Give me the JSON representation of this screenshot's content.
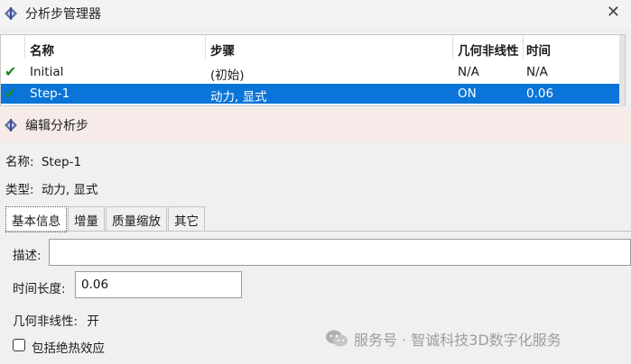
{
  "step_manager": {
    "title": "分析步管理器",
    "columns": [
      "名称",
      "步骤",
      "几何非线性",
      "时间"
    ],
    "rows": [
      {
        "check": "✔",
        "name": "Initial",
        "procedure": "(初始)",
        "nlgeom": "N/A",
        "time": "N/A",
        "selected": false
      },
      {
        "check": "✔",
        "name": "Step-1",
        "procedure": "动力, 显式",
        "nlgeom": "ON",
        "time": "0.06",
        "selected": true
      }
    ]
  },
  "edit_step": {
    "title": "编辑分析步",
    "name_label": "名称:",
    "name_value": "Step-1",
    "type_label": "类型:",
    "type_value": "动力, 显式",
    "tabs": [
      "基本信息",
      "增量",
      "质量缩放",
      "其它"
    ],
    "active_tab": 0,
    "description_label": "描述:",
    "description_value": "",
    "time_period_label": "时间长度:",
    "time_period_value": "0.06",
    "nlgeom_label": "几何非线性:",
    "nlgeom_value": "开",
    "adiabatic_label": "包括绝热效应",
    "adiabatic_checked": false
  },
  "watermark": "服务号 · 智诚科技3D数字化服务",
  "colors": {
    "selection": "#0a74d8",
    "check": "#1c8a1c",
    "dialog_header": "#f6ebe8"
  }
}
